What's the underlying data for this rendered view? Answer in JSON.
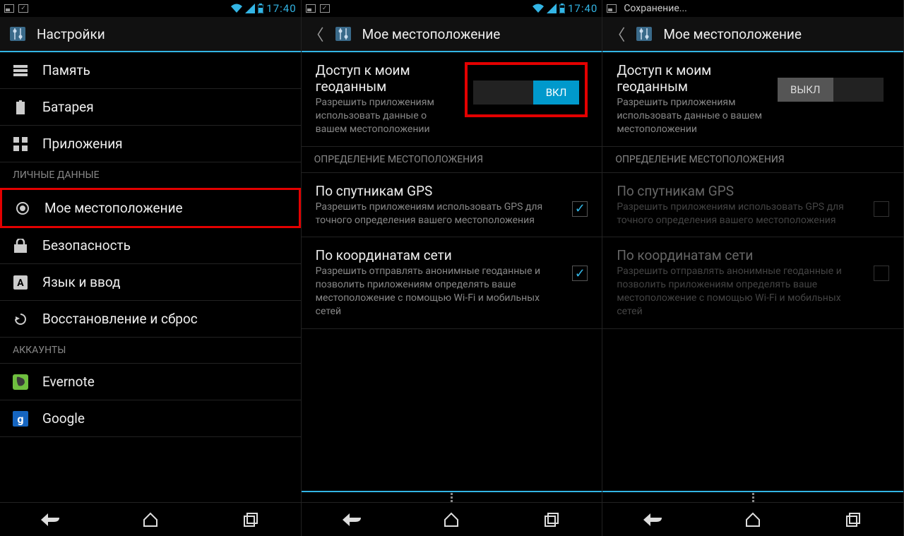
{
  "statusbar": {
    "time": "17:40",
    "saving": "Сохранение..."
  },
  "screen1": {
    "header_title": "Настройки",
    "items": {
      "memory": "Память",
      "battery": "Батарея",
      "apps": "Приложения",
      "location": "Мое местоположение",
      "security": "Безопасность",
      "language": "Язык и ввод",
      "backup": "Восстановление и сброс",
      "evernote": "Evernote",
      "google": "Google"
    },
    "sections": {
      "personal": "ЛИЧНЫЕ ДАННЫЕ",
      "accounts": "АККАУНТЫ"
    }
  },
  "screen2": {
    "header_title": "Мое местоположение",
    "access_title": "Доступ к моим геоданным",
    "access_desc": "Разрешить приложениям использовать данные о вашем местоположении",
    "toggle_on_label": "ВКЛ",
    "section_sources": "ОПРЕДЕЛЕНИЕ МЕСТОПОЛОЖЕНИЯ",
    "gps_title": "По спутникам GPS",
    "gps_desc": "Разрешить приложениям использовать GPS для точного определения вашего местоположения",
    "network_title": "По координатам сети",
    "network_desc": "Разрешить отправлять анонимные геоданные и позволить приложениям определять ваше местоположение с помощью Wi-Fi и мобильных сетей"
  },
  "screen3": {
    "header_title": "Мое местоположение",
    "access_title": "Доступ к моим геоданным",
    "access_desc": "Разрешить приложениям использовать данные о вашем местоположении",
    "toggle_off_label": "ВЫКЛ",
    "section_sources": "ОПРЕДЕЛЕНИЕ МЕСТОПОЛОЖЕНИЯ",
    "gps_title": "По спутникам GPS",
    "gps_desc": "Разрешить приложениям использовать GPS для точного определения вашего местоположения",
    "network_title": "По координатам сети",
    "network_desc": "Разрешить отправлять анонимные геоданные и позволить приложениям определять ваше местоположение с помощью Wi-Fi и мобильных сетей"
  }
}
